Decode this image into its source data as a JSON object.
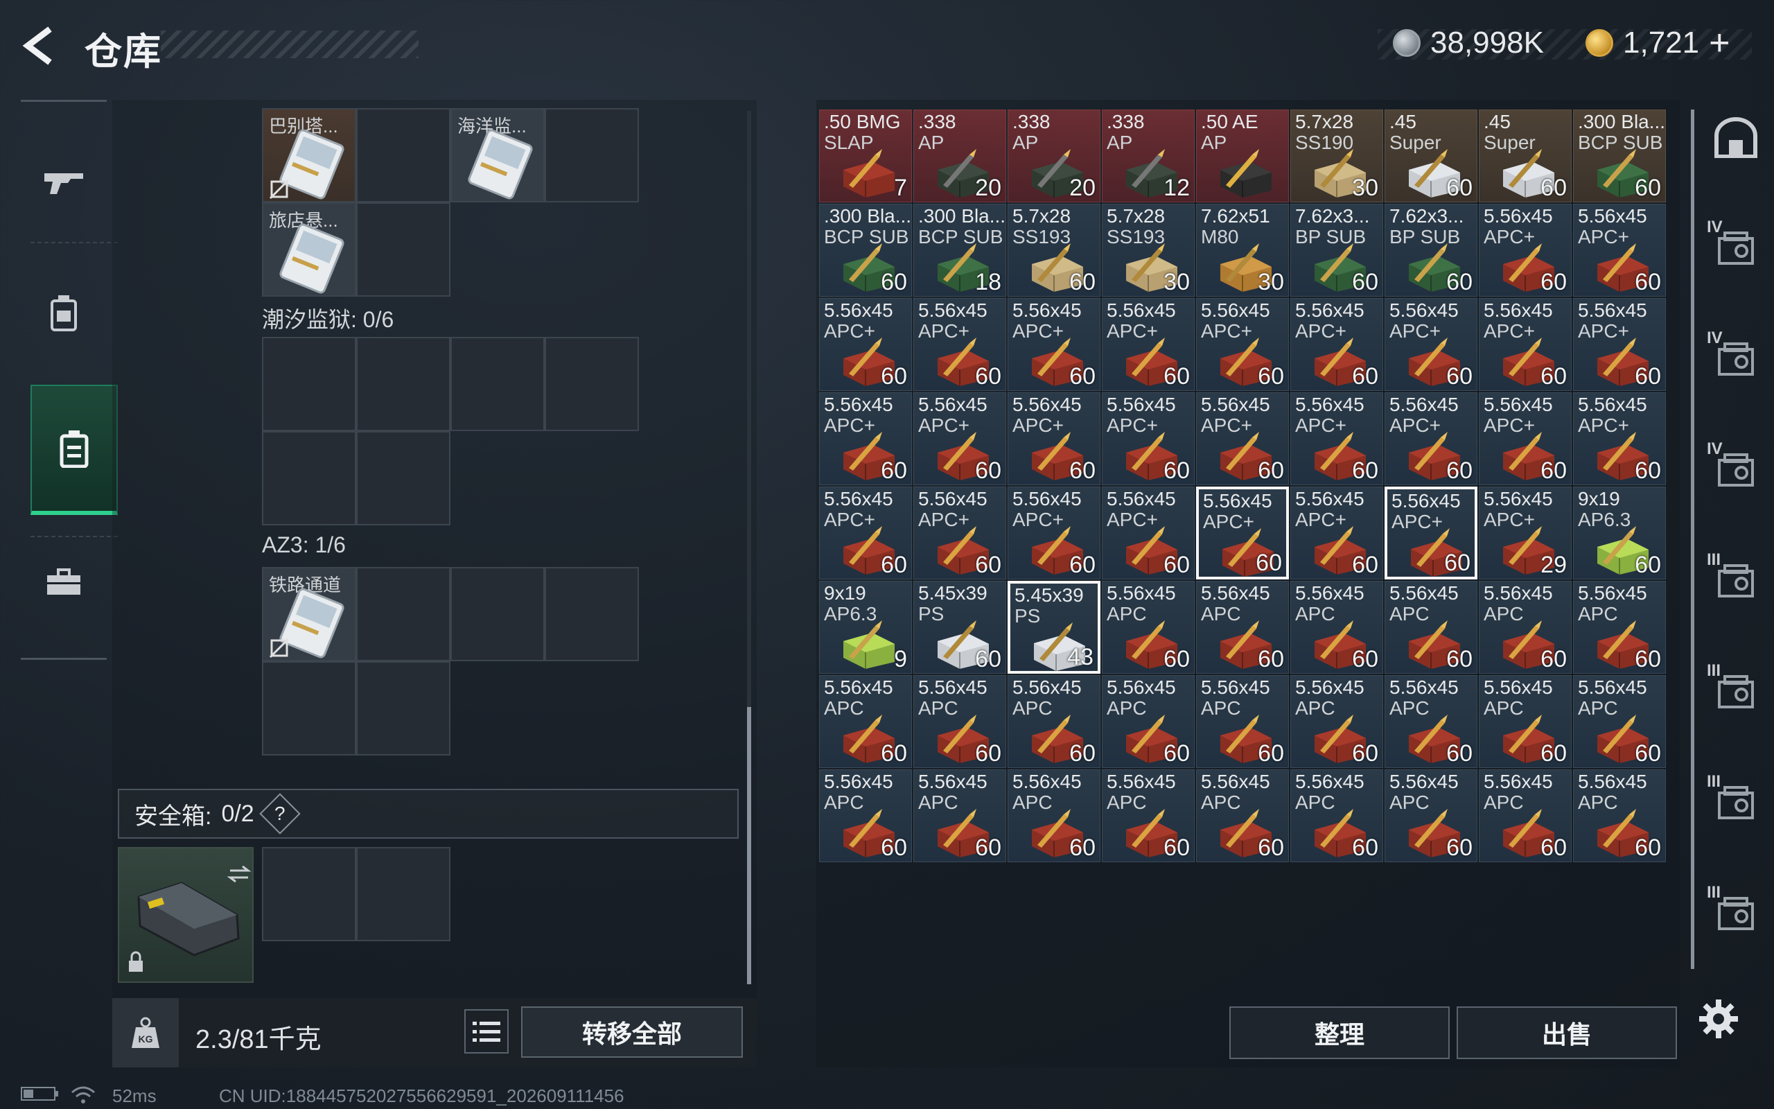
{
  "header": {
    "title": "仓库"
  },
  "currency": {
    "silver": "38,998K",
    "gold": "1,721",
    "add": "+"
  },
  "left_nav": [
    "weapon-icon",
    "gear-bag-icon",
    "backpack-icon",
    "toolbox-icon"
  ],
  "keys": {
    "top_labels": [
      "巴别塔...",
      "海洋监...",
      "旅店悬..."
    ],
    "section_tide": "潮汐监狱: 0/6",
    "section_az3": "AZ3: 1/6",
    "az3_label": "铁路通道"
  },
  "safe": {
    "label": "安全箱:",
    "value": "0/2",
    "help": "?"
  },
  "weight": "2.3/81千克",
  "transfer_all": "转移全部",
  "sort": "整理",
  "sell": "出售",
  "status": {
    "ping": "52ms",
    "uid": "CN UID:1884457520275566295​91_202609111456"
  },
  "grid_items": [
    {
      "n1": ".50 BMG",
      "n2": "SLAP",
      "c": "7",
      "bg": "red",
      "ic": "box-red"
    },
    {
      "n1": ".338",
      "n2": "AP",
      "c": "20",
      "bg": "red",
      "ic": "can"
    },
    {
      "n1": ".338",
      "n2": "AP",
      "c": "20",
      "bg": "red",
      "ic": "can"
    },
    {
      "n1": ".338",
      "n2": "AP",
      "c": "12",
      "bg": "red",
      "ic": "can"
    },
    {
      "n1": ".50 AE",
      "n2": "AP",
      "c": "",
      "bg": "red",
      "ic": "bullet-gold"
    },
    {
      "n1": "5.7x28",
      "n2": "SS190",
      "c": "30",
      "bg": "brown",
      "ic": "box-tan"
    },
    {
      "n1": ".45",
      "n2": "Super",
      "c": "60",
      "bg": "brown",
      "ic": "box-white"
    },
    {
      "n1": ".45",
      "n2": "Super",
      "c": "60",
      "bg": "brown",
      "ic": "box-white"
    },
    {
      "n1": ".300 Bla...",
      "n2": "BCP SUB",
      "c": "60",
      "bg": "brown",
      "ic": "box-green"
    },
    {
      "n1": ".300 Bla...",
      "n2": "BCP SUB",
      "c": "60",
      "bg": "blue",
      "ic": "box-green"
    },
    {
      "n1": ".300 Bla...",
      "n2": "BCP SUB",
      "c": "18",
      "bg": "blue",
      "ic": "box-green"
    },
    {
      "n1": "5.7x28",
      "n2": "SS193",
      "c": "60",
      "bg": "blue",
      "ic": "box-tan"
    },
    {
      "n1": "5.7x28",
      "n2": "SS193",
      "c": "30",
      "bg": "blue",
      "ic": "box-tan"
    },
    {
      "n1": "7.62x51",
      "n2": "M80",
      "c": "30",
      "bg": "blue",
      "ic": "box-orange"
    },
    {
      "n1": "7.62x3...",
      "n2": "BP SUB",
      "c": "60",
      "bg": "blue",
      "ic": "box-green"
    },
    {
      "n1": "7.62x3...",
      "n2": "BP SUB",
      "c": "60",
      "bg": "blue",
      "ic": "box-green"
    },
    {
      "n1": "5.56x45",
      "n2": "APC+",
      "c": "60",
      "bg": "blue",
      "ic": "box-red"
    },
    {
      "n1": "5.56x45",
      "n2": "APC+",
      "c": "60",
      "bg": "blue",
      "ic": "box-red"
    },
    {
      "n1": "5.56x45",
      "n2": "APC+",
      "c": "60",
      "bg": "blue",
      "ic": "box-red"
    },
    {
      "n1": "5.56x45",
      "n2": "APC+",
      "c": "60",
      "bg": "blue",
      "ic": "box-red"
    },
    {
      "n1": "5.56x45",
      "n2": "APC+",
      "c": "60",
      "bg": "blue",
      "ic": "box-red"
    },
    {
      "n1": "5.56x45",
      "n2": "APC+",
      "c": "60",
      "bg": "blue",
      "ic": "box-red"
    },
    {
      "n1": "5.56x45",
      "n2": "APC+",
      "c": "60",
      "bg": "blue",
      "ic": "box-red"
    },
    {
      "n1": "5.56x45",
      "n2": "APC+",
      "c": "60",
      "bg": "blue",
      "ic": "box-red"
    },
    {
      "n1": "5.56x45",
      "n2": "APC+",
      "c": "60",
      "bg": "blue",
      "ic": "box-red"
    },
    {
      "n1": "5.56x45",
      "n2": "APC+",
      "c": "60",
      "bg": "blue",
      "ic": "box-red"
    },
    {
      "n1": "5.56x45",
      "n2": "APC+",
      "c": "60",
      "bg": "blue",
      "ic": "box-red"
    },
    {
      "n1": "5.56x45",
      "n2": "APC+",
      "c": "60",
      "bg": "blue",
      "ic": "box-red"
    },
    {
      "n1": "5.56x45",
      "n2": "APC+",
      "c": "60",
      "bg": "blue",
      "ic": "box-red"
    },
    {
      "n1": "5.56x45",
      "n2": "APC+",
      "c": "60",
      "bg": "blue",
      "ic": "box-red"
    },
    {
      "n1": "5.56x45",
      "n2": "APC+",
      "c": "60",
      "bg": "blue",
      "ic": "box-red"
    },
    {
      "n1": "5.56x45",
      "n2": "APC+",
      "c": "60",
      "bg": "blue",
      "ic": "box-red"
    },
    {
      "n1": "5.56x45",
      "n2": "APC+",
      "c": "60",
      "bg": "blue",
      "ic": "box-red"
    },
    {
      "n1": "5.56x45",
      "n2": "APC+",
      "c": "60",
      "bg": "blue",
      "ic": "box-red"
    },
    {
      "n1": "5.56x45",
      "n2": "APC+",
      "c": "60",
      "bg": "blue",
      "ic": "box-red"
    },
    {
      "n1": "5.56x45",
      "n2": "APC+",
      "c": "60",
      "bg": "blue",
      "ic": "box-red"
    },
    {
      "n1": "5.56x45",
      "n2": "APC+",
      "c": "60",
      "bg": "blue",
      "ic": "box-red"
    },
    {
      "n1": "5.56x45",
      "n2": "APC+",
      "c": "60",
      "bg": "blue",
      "ic": "box-red"
    },
    {
      "n1": "5.56x45",
      "n2": "APC+",
      "c": "60",
      "bg": "blue",
      "ic": "box-red"
    },
    {
      "n1": "5.56x45",
      "n2": "APC+",
      "c": "60",
      "bg": "blue",
      "ic": "box-red"
    },
    {
      "n1": "5.56x45",
      "n2": "APC+",
      "c": "60",
      "bg": "blue",
      "ic": "box-red",
      "sel": true
    },
    {
      "n1": "5.56x45",
      "n2": "APC+",
      "c": "60",
      "bg": "blue",
      "ic": "box-red"
    },
    {
      "n1": "5.56x45",
      "n2": "APC+",
      "c": "60",
      "bg": "blue",
      "ic": "box-red",
      "sel": true
    },
    {
      "n1": "5.56x45",
      "n2": "APC+",
      "c": "29",
      "bg": "blue",
      "ic": "box-red"
    },
    {
      "n1": "9x19",
      "n2": "AP6.3",
      "c": "60",
      "bg": "blue",
      "ic": "box-lime"
    },
    {
      "n1": "9x19",
      "n2": "AP6.3",
      "c": "9",
      "bg": "blue",
      "ic": "box-lime"
    },
    {
      "n1": "5.45x39",
      "n2": "PS",
      "c": "60",
      "bg": "blue",
      "ic": "box-white"
    },
    {
      "n1": "5.45x39",
      "n2": "PS",
      "c": "43",
      "bg": "blue",
      "ic": "box-white",
      "sel": true
    },
    {
      "n1": "5.56x45",
      "n2": "APC",
      "c": "60",
      "bg": "blue",
      "ic": "box-red"
    },
    {
      "n1": "5.56x45",
      "n2": "APC",
      "c": "60",
      "bg": "blue",
      "ic": "box-red"
    },
    {
      "n1": "5.56x45",
      "n2": "APC",
      "c": "60",
      "bg": "blue",
      "ic": "box-red"
    },
    {
      "n1": "5.56x45",
      "n2": "APC",
      "c": "60",
      "bg": "blue",
      "ic": "box-red"
    },
    {
      "n1": "5.56x45",
      "n2": "APC",
      "c": "60",
      "bg": "blue",
      "ic": "box-red"
    },
    {
      "n1": "5.56x45",
      "n2": "APC",
      "c": "60",
      "bg": "blue",
      "ic": "box-red"
    },
    {
      "n1": "5.56x45",
      "n2": "APC",
      "c": "60",
      "bg": "blue",
      "ic": "box-red"
    },
    {
      "n1": "5.56x45",
      "n2": "APC",
      "c": "60",
      "bg": "blue",
      "ic": "box-red"
    },
    {
      "n1": "5.56x45",
      "n2": "APC",
      "c": "60",
      "bg": "blue",
      "ic": "box-red"
    },
    {
      "n1": "5.56x45",
      "n2": "APC",
      "c": "60",
      "bg": "blue",
      "ic": "box-red"
    },
    {
      "n1": "5.56x45",
      "n2": "APC",
      "c": "60",
      "bg": "blue",
      "ic": "box-red"
    },
    {
      "n1": "5.56x45",
      "n2": "APC",
      "c": "60",
      "bg": "blue",
      "ic": "box-red"
    },
    {
      "n1": "5.56x45",
      "n2": "APC",
      "c": "60",
      "bg": "blue",
      "ic": "box-red"
    },
    {
      "n1": "5.56x45",
      "n2": "APC",
      "c": "60",
      "bg": "blue",
      "ic": "box-red"
    },
    {
      "n1": "5.56x45",
      "n2": "APC",
      "c": "60",
      "bg": "blue",
      "ic": "box-red"
    },
    {
      "n1": "5.56x45",
      "n2": "APC",
      "c": "60",
      "bg": "blue",
      "ic": "box-red"
    },
    {
      "n1": "5.56x45",
      "n2": "APC",
      "c": "60",
      "bg": "blue",
      "ic": "box-red"
    },
    {
      "n1": "5.56x45",
      "n2": "APC",
      "c": "60",
      "bg": "blue",
      "ic": "box-red"
    },
    {
      "n1": "5.56x45",
      "n2": "APC",
      "c": "60",
      "bg": "blue",
      "ic": "box-red"
    },
    {
      "n1": "5.56x45",
      "n2": "APC",
      "c": "60",
      "bg": "blue",
      "ic": "box-red"
    },
    {
      "n1": "5.56x45",
      "n2": "APC",
      "c": "60",
      "bg": "blue",
      "ic": "box-red"
    },
    {
      "n1": "5.56x45",
      "n2": "APC",
      "c": "60",
      "bg": "blue",
      "ic": "box-red"
    },
    {
      "n1": "5.56x45",
      "n2": "APC",
      "c": "60",
      "bg": "blue",
      "ic": "box-red"
    },
    {
      "n1": "5.56x45",
      "n2": "APC",
      "c": "60",
      "bg": "blue",
      "ic": "box-red"
    }
  ],
  "rail_levels": [
    "",
    "IV",
    "IV",
    "IV",
    "III",
    "III",
    "III",
    "III"
  ],
  "colors": {
    "accent_green": "#2fd08e",
    "slot_blue": "#263646",
    "slot_red": "#5a282d"
  }
}
